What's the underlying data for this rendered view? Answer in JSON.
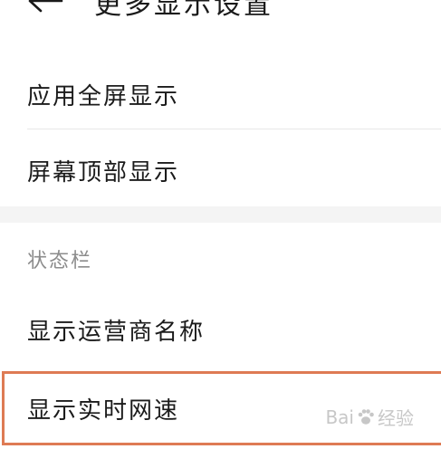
{
  "header": {
    "back_icon": "arrow-left-icon",
    "title": "更多显示设置"
  },
  "rows": [
    {
      "label": "应用全屏显示"
    },
    {
      "label": "屏幕顶部显示"
    }
  ],
  "status_bar_section": {
    "label": "状态栏",
    "rows": [
      {
        "label": "显示运营商名称"
      },
      {
        "label": "显示实时网速"
      }
    ]
  },
  "highlight_color": "#de7b54",
  "watermark": {
    "text_left": "Bai",
    "text_right": "经验"
  }
}
